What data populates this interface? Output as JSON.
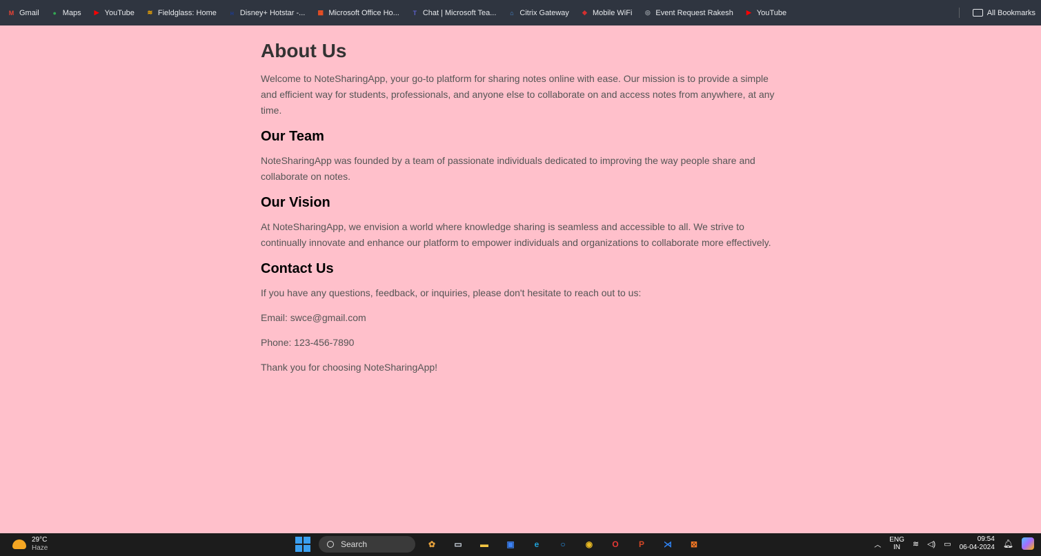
{
  "bookmarks": [
    {
      "label": "Gmail",
      "icon": "gmail-icon",
      "color": "#ea4335",
      "glyph": "M"
    },
    {
      "label": "Maps",
      "icon": "maps-icon",
      "color": "#34a853",
      "glyph": "●"
    },
    {
      "label": "YouTube",
      "icon": "youtube-icon",
      "color": "#ff0000",
      "glyph": "▶"
    },
    {
      "label": "Fieldglass: Home",
      "icon": "fieldglass-icon",
      "color": "#f9ab00",
      "glyph": "≋"
    },
    {
      "label": "Disney+ Hotstar -...",
      "icon": "hotstar-icon",
      "color": "#1f3a8a",
      "glyph": "ʜ"
    },
    {
      "label": "Microsoft Office Ho...",
      "icon": "office-icon",
      "color": "#f25022",
      "glyph": "▦"
    },
    {
      "label": "Chat | Microsoft Tea...",
      "icon": "teams-icon",
      "color": "#5b5fc7",
      "glyph": "T"
    },
    {
      "label": "Citrix Gateway",
      "icon": "citrix-icon",
      "color": "#4a8fd8",
      "glyph": "⌂"
    },
    {
      "label": "Mobile WiFi",
      "icon": "wifi-icon",
      "color": "#d32f2f",
      "glyph": "◆"
    },
    {
      "label": "Event Request Rakesh",
      "icon": "globe-icon",
      "color": "#9aa0a6",
      "glyph": "◎"
    },
    {
      "label": "YouTube",
      "icon": "youtube-icon",
      "color": "#ff0000",
      "glyph": "▶"
    }
  ],
  "all_bookmarks": "All Bookmarks",
  "page": {
    "title": "About Us",
    "intro": "Welcome to NoteSharingApp, your go-to platform for sharing notes online with ease. Our mission is to provide a simple and efficient way for students, professionals, and anyone else to collaborate on and access notes from anywhere, at any time.",
    "team_heading": "Our Team",
    "team_text": "NoteSharingApp was founded by a team of passionate individuals dedicated to improving the way people share and collaborate on notes.",
    "vision_heading": "Our Vision",
    "vision_text": "At NoteSharingApp, we envision a world where knowledge sharing is seamless and accessible to all. We strive to continually innovate and enhance our platform to empower individuals and organizations to collaborate more effectively.",
    "contact_heading": "Contact Us",
    "contact_text": "If you have any questions, feedback, or inquiries, please don't hesitate to reach out to us:",
    "email": "Email: swce@gmail.com",
    "phone": "Phone: 123-456-7890",
    "thanks": "Thank you for choosing NoteSharingApp!"
  },
  "colors": {
    "background": "#ffc0cb",
    "bookmarks_bar": "#2f3540",
    "taskbar": "#1c1c1c"
  },
  "taskbar": {
    "weather_temp": "29°C",
    "weather_desc": "Haze",
    "search_label": "Search",
    "apps": [
      {
        "name": "widgets-app-icon",
        "color": "#e8a33d",
        "glyph": "✿"
      },
      {
        "name": "task-view-icon",
        "color": "#cfd8e3",
        "glyph": "▭"
      },
      {
        "name": "file-explorer-icon",
        "color": "#f4c542",
        "glyph": "▬"
      },
      {
        "name": "store-icon",
        "color": "#3b82f6",
        "glyph": "▣"
      },
      {
        "name": "edge-icon",
        "color": "#1fa2d9",
        "glyph": "e"
      },
      {
        "name": "cortana-icon",
        "color": "#2b9af3",
        "glyph": "○"
      },
      {
        "name": "chrome-icon",
        "color": "#e8b923",
        "glyph": "◉"
      },
      {
        "name": "opera-icon",
        "color": "#e53935",
        "glyph": "O"
      },
      {
        "name": "powerpoint-icon",
        "color": "#d24726",
        "glyph": "P"
      },
      {
        "name": "vscode-icon",
        "color": "#2f80ed",
        "glyph": "⋊"
      },
      {
        "name": "xampp-icon",
        "color": "#fb7a24",
        "glyph": "⊠"
      }
    ],
    "lang_top": "ENG",
    "lang_bottom": "IN",
    "time": "09:54",
    "date": "06-04-2024"
  }
}
